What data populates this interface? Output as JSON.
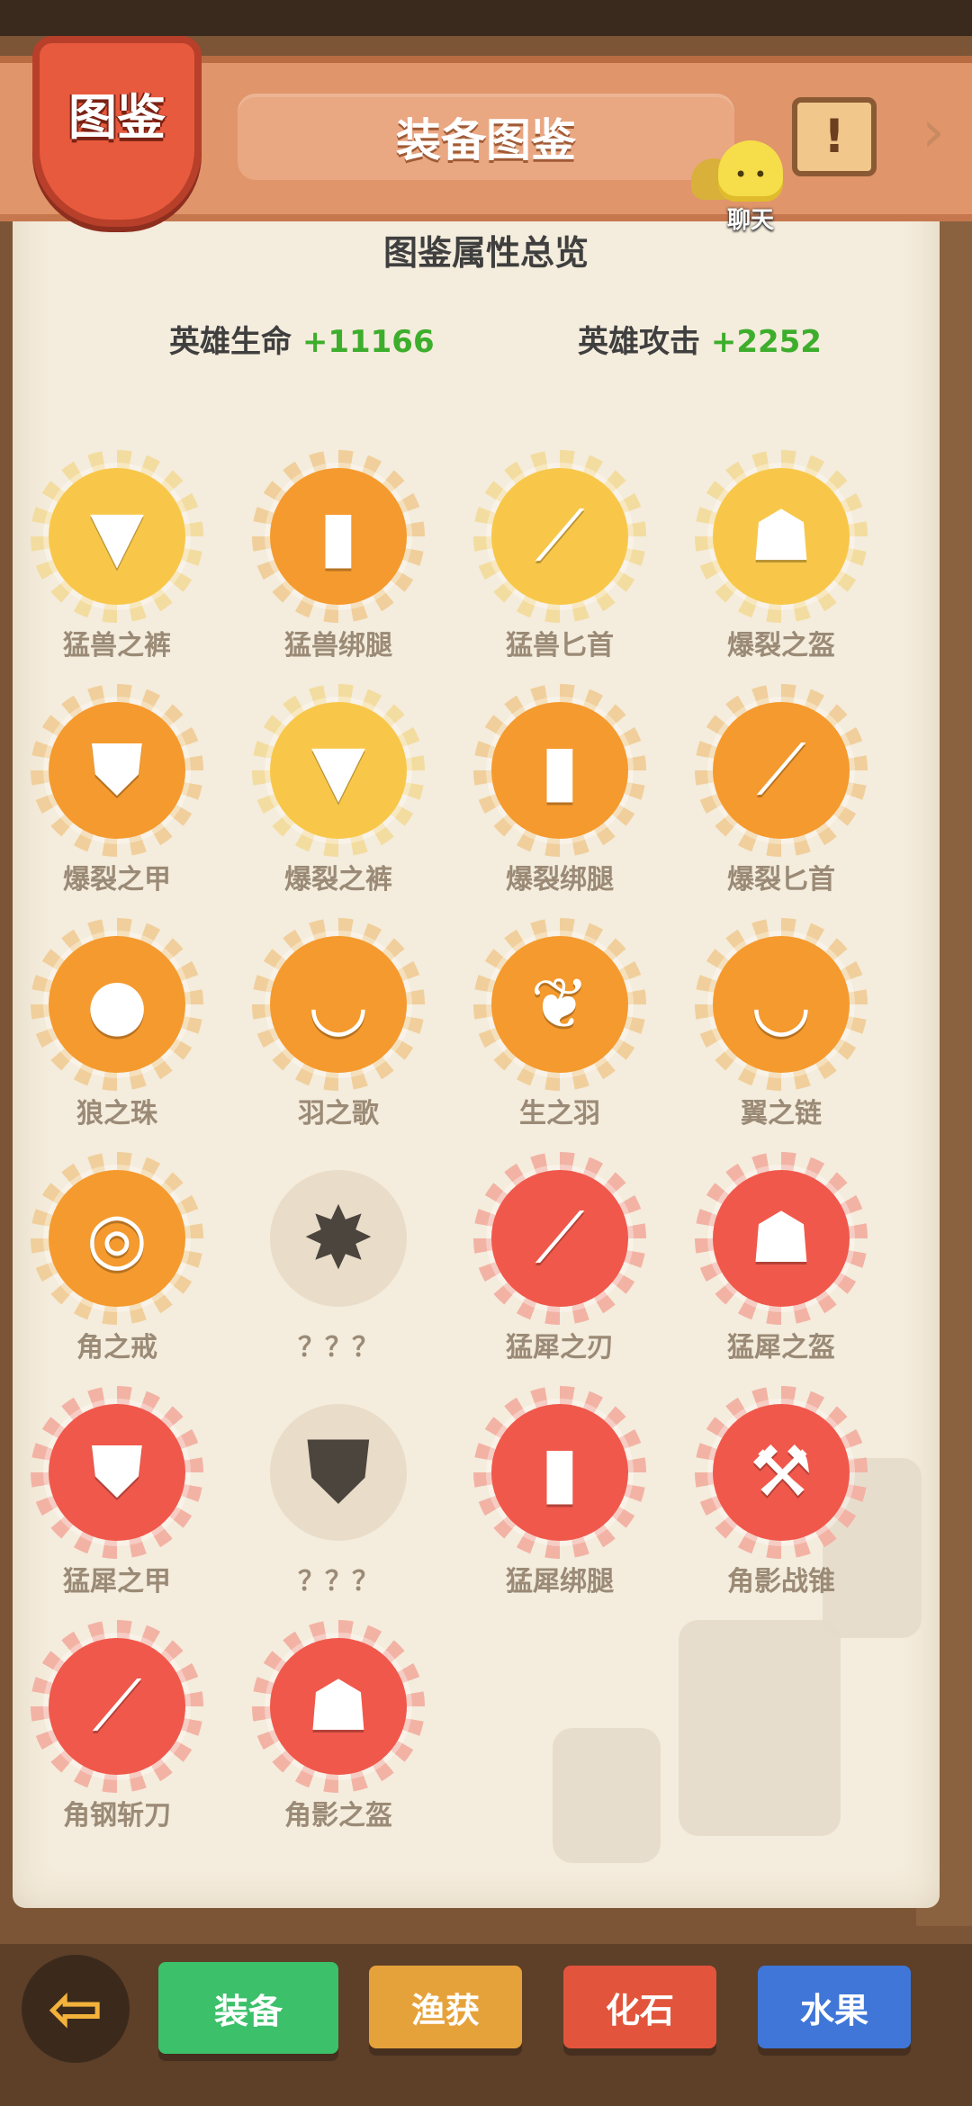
{
  "header": {
    "badge": "图鉴",
    "title": "装备图鉴",
    "chat_label": "聊天"
  },
  "overview": {
    "title": "图鉴属性总览",
    "hp_label": "英雄生命",
    "hp_value": "+11166",
    "atk_label": "英雄攻击",
    "atk_value": "+2252"
  },
  "items": [
    {
      "name": "猛兽之裤",
      "color": "yellow",
      "icon": "pants-icon",
      "glyph": "▼"
    },
    {
      "name": "猛兽绑腿",
      "color": "orange",
      "icon": "leggings-icon",
      "glyph": "▮"
    },
    {
      "name": "猛兽匕首",
      "color": "yellow",
      "icon": "dagger-icon",
      "glyph": "⟋"
    },
    {
      "name": "爆裂之盔",
      "color": "yellow",
      "icon": "helmet-icon",
      "glyph": "☗"
    },
    {
      "name": "爆裂之甲",
      "color": "orange",
      "icon": "armor-icon",
      "glyph": "⛊"
    },
    {
      "name": "爆裂之裤",
      "color": "yellow",
      "icon": "pants-icon",
      "glyph": "▼"
    },
    {
      "name": "爆裂绑腿",
      "color": "orange",
      "icon": "leggings-icon",
      "glyph": "▮"
    },
    {
      "name": "爆裂匕首",
      "color": "orange",
      "icon": "dagger-icon",
      "glyph": "⟋"
    },
    {
      "name": "狼之珠",
      "color": "orange",
      "icon": "orb-icon",
      "glyph": "●"
    },
    {
      "name": "羽之歌",
      "color": "orange",
      "icon": "necklace-icon",
      "glyph": "◡"
    },
    {
      "name": "生之羽",
      "color": "orange",
      "icon": "feather-icon",
      "glyph": "❦"
    },
    {
      "name": "翼之链",
      "color": "orange",
      "icon": "necklace-icon",
      "glyph": "◡"
    },
    {
      "name": "角之戒",
      "color": "orange",
      "icon": "ring-icon",
      "glyph": "◎"
    },
    {
      "name": "？？？",
      "color": "locked",
      "icon": "locked-item-icon",
      "glyph": "✸"
    },
    {
      "name": "猛犀之刃",
      "color": "red",
      "icon": "sword-icon",
      "glyph": "⟋"
    },
    {
      "name": "猛犀之盔",
      "color": "red",
      "icon": "helmet-icon",
      "glyph": "☗"
    },
    {
      "name": "猛犀之甲",
      "color": "red",
      "icon": "armor-icon",
      "glyph": "⛊"
    },
    {
      "name": "？？？",
      "color": "locked",
      "icon": "locked-item-icon",
      "glyph": "⛊"
    },
    {
      "name": "猛犀绑腿",
      "color": "red",
      "icon": "leggings-icon",
      "glyph": "▮"
    },
    {
      "name": "角影战锥",
      "color": "red",
      "icon": "hammer-icon",
      "glyph": "⚒"
    },
    {
      "name": "角钢斩刀",
      "color": "red",
      "icon": "blade-icon",
      "glyph": "⟋"
    },
    {
      "name": "角影之盔",
      "color": "red",
      "icon": "helmet-icon",
      "glyph": "☗"
    }
  ],
  "nav": {
    "back_icon": "back-arrow-icon",
    "tabs": [
      {
        "label": "装备",
        "color": "#3cc06a"
      },
      {
        "label": "渔获",
        "color": "#e6a23a"
      },
      {
        "label": "化石",
        "color": "#e2553c"
      },
      {
        "label": "水果",
        "color": "#3f76d8"
      }
    ]
  }
}
